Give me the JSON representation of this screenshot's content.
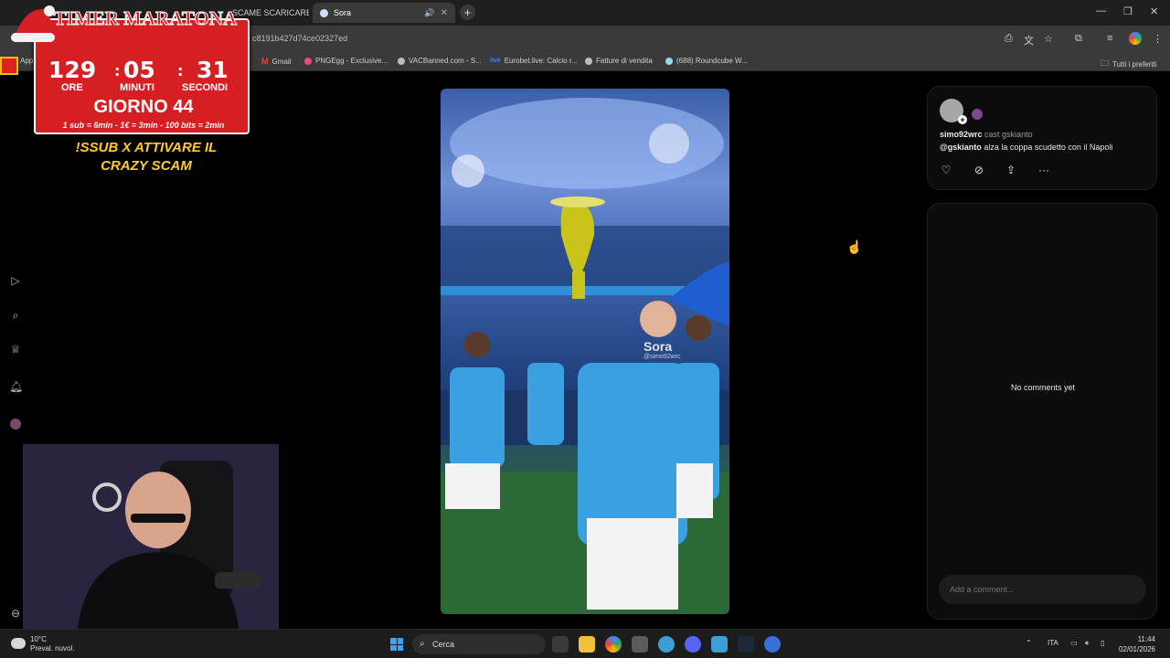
{
  "browser": {
    "tabs": [
      {
        "label": "",
        "active": false
      },
      {
        "label": "SCAME SCARICARE",
        "active": false
      },
      {
        "label": "Sora",
        "active": true
      }
    ],
    "new_tab_icon": "plus-icon",
    "url": "c8191b427d74ce02327ed",
    "bookmarks": [
      {
        "label": "App"
      },
      {
        "label": "Gmail"
      },
      {
        "label": "PNGEgg - Exclusive..."
      },
      {
        "label": "VACBanned.com - S..."
      },
      {
        "label": "Eurobet.live: Calcio r..."
      },
      {
        "label": "Fatture di vendita"
      },
      {
        "label": "(688) Roundcube W..."
      }
    ],
    "all_bookmarks": "Tutti i preferiti"
  },
  "overlay": {
    "timer_title": "TIMER MARATONA",
    "hours": "129",
    "minutes": "05",
    "seconds": "31",
    "hours_label": "ORE",
    "minutes_label": "MINUTI",
    "seconds_label": "SECONDI",
    "separator": ":",
    "day": "GIORNO 44",
    "rate": "1 sub = 6min - 1€ = 3min - 100 bits = 2min",
    "promo": "!SSUB X ATTIVARE IL CRAZY SCAM"
  },
  "video": {
    "watermark": "Sora",
    "handle": "@simo92wrc"
  },
  "post": {
    "author": "simo92wrc",
    "cast_text": "cast gskianto",
    "mention": "@gskianto",
    "caption": "alza la coppa scudetto con il Napoli",
    "actions": [
      "heart-icon",
      "remix-icon",
      "share-icon",
      "more-icon"
    ]
  },
  "comments": {
    "empty_text": "No comments yet",
    "input_placeholder": "Add a comment..."
  },
  "taskbar": {
    "temperature": "10°C",
    "weather": "Preval. nuvol.",
    "search": "Cerca",
    "language": "ITA",
    "time": "11:44",
    "date": "02/01/2026"
  }
}
